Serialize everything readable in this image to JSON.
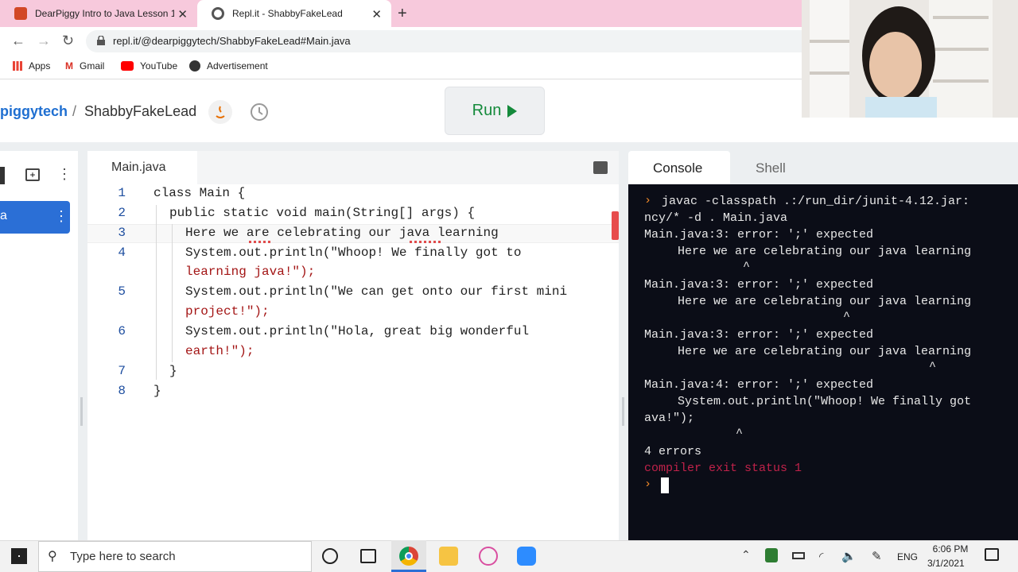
{
  "browser": {
    "tabs": [
      {
        "label": "DearPiggy Intro to Java Lesson 1",
        "favicon_color": "#d24726"
      },
      {
        "label": "Repl.it - ShabbyFakeLead",
        "favicon_color": "#555555"
      }
    ],
    "url": "repl.it/@dearpiggytech/ShabbyFakeLead#Main.java",
    "bookmarks": [
      "Apps",
      "Gmail",
      "YouTube",
      "Advertisement"
    ]
  },
  "repl": {
    "owner": "piggytech",
    "separator": "/",
    "name": "ShabbyFakeLead",
    "run_label": "Run",
    "file_tab": "Main.java",
    "file_active_label": "a",
    "code_lines": [
      {
        "num": "1",
        "text": "class Main {"
      },
      {
        "num": "2",
        "text": "public static void main(String[] args) {"
      },
      {
        "num": "3",
        "text": "Here we are celebrating our java learning"
      },
      {
        "num": "4",
        "text": "System.out.println(\"Whoop! We finally got to",
        "cont": "learning java!\");"
      },
      {
        "num": "5",
        "text": "System.out.println(\"We can get onto our first mini",
        "cont": "project!\");"
      },
      {
        "num": "6",
        "text": "System.out.println(\"Hola, great big wonderful",
        "cont": "earth!\");"
      },
      {
        "num": "7",
        "text": "}"
      },
      {
        "num": "8",
        "text": "}"
      }
    ]
  },
  "console": {
    "tab_console": "Console",
    "tab_shell": "Shell",
    "lines": [
      "javac -classpath .:/run_dir/junit-4.12.jar:",
      "ncy/* -d . Main.java",
      "Main.java:3: error: ';' expected",
      "    Here we are celebrating our java learning",
      "            ^",
      "Main.java:3: error: ';' expected",
      "    Here we are celebrating our java learning",
      "                          ^",
      "Main.java:3: error: ';' expected",
      "    Here we are celebrating our java learning",
      "                                      ^",
      "Main.java:4: error: ';' expected",
      "    System.out.println(\"Whoop! We finally got",
      "ava!\");",
      "           ^",
      "4 errors",
      "compiler exit status 1"
    ],
    "prompt_symbol": "›"
  },
  "taskbar": {
    "search_placeholder": "Type here to search",
    "lang": "ENG",
    "time": "6:06 PM",
    "date": "3/1/2021"
  }
}
